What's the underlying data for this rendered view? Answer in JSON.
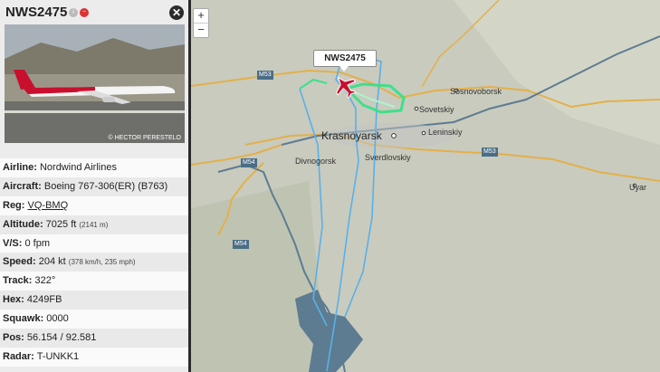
{
  "flight": {
    "callsign": "NWS2475"
  },
  "photo": {
    "credit": "© HECTOR PERESTELO"
  },
  "details": {
    "airline_label": "Airline:",
    "airline": "Nordwind Airlines",
    "aircraft_label": "Aircraft:",
    "aircraft": "Boeing 767-306(ER) (B763)",
    "reg_label": "Reg:",
    "reg": "VQ-BMQ",
    "altitude_label": "Altitude:",
    "altitude": "7025 ft",
    "altitude_m": "(2141 m)",
    "vs_label": "V/S:",
    "vs": "0 fpm",
    "speed_label": "Speed:",
    "speed": "204 kt",
    "speed_sub": "(378 km/h, 235 mph)",
    "track_label": "Track:",
    "track": "322°",
    "hex_label": "Hex:",
    "hex": "4249FB",
    "squawk_label": "Squawk:",
    "squawk": "0000",
    "pos_label": "Pos:",
    "pos": "56.154 / 92.581",
    "radar_label": "Radar:",
    "radar": "T-UNKK1"
  },
  "map": {
    "zoom_in": "+",
    "zoom_out": "−",
    "callout": "NWS2475",
    "places": {
      "sosnovoborsk": "Sosnovoborsk",
      "sovetskiy": "Sovetskiy",
      "krasnoyarsk": "Krasnoyarsk",
      "leninskiy": "Leninskiy",
      "divnogorsk": "Divnogorsk",
      "sverdlovskiy": "Sverdlovskiy",
      "uyar": "Uyar"
    },
    "roads": {
      "r1": "M53",
      "r2": "M53",
      "r3": "M54",
      "r4": "M54"
    },
    "colors": {
      "track_blue": "#5ab0e8",
      "track_green": "#3ee08a",
      "aircraft_red": "#c8102e",
      "road": "#e3b04b",
      "river": "#5d7c91"
    }
  }
}
